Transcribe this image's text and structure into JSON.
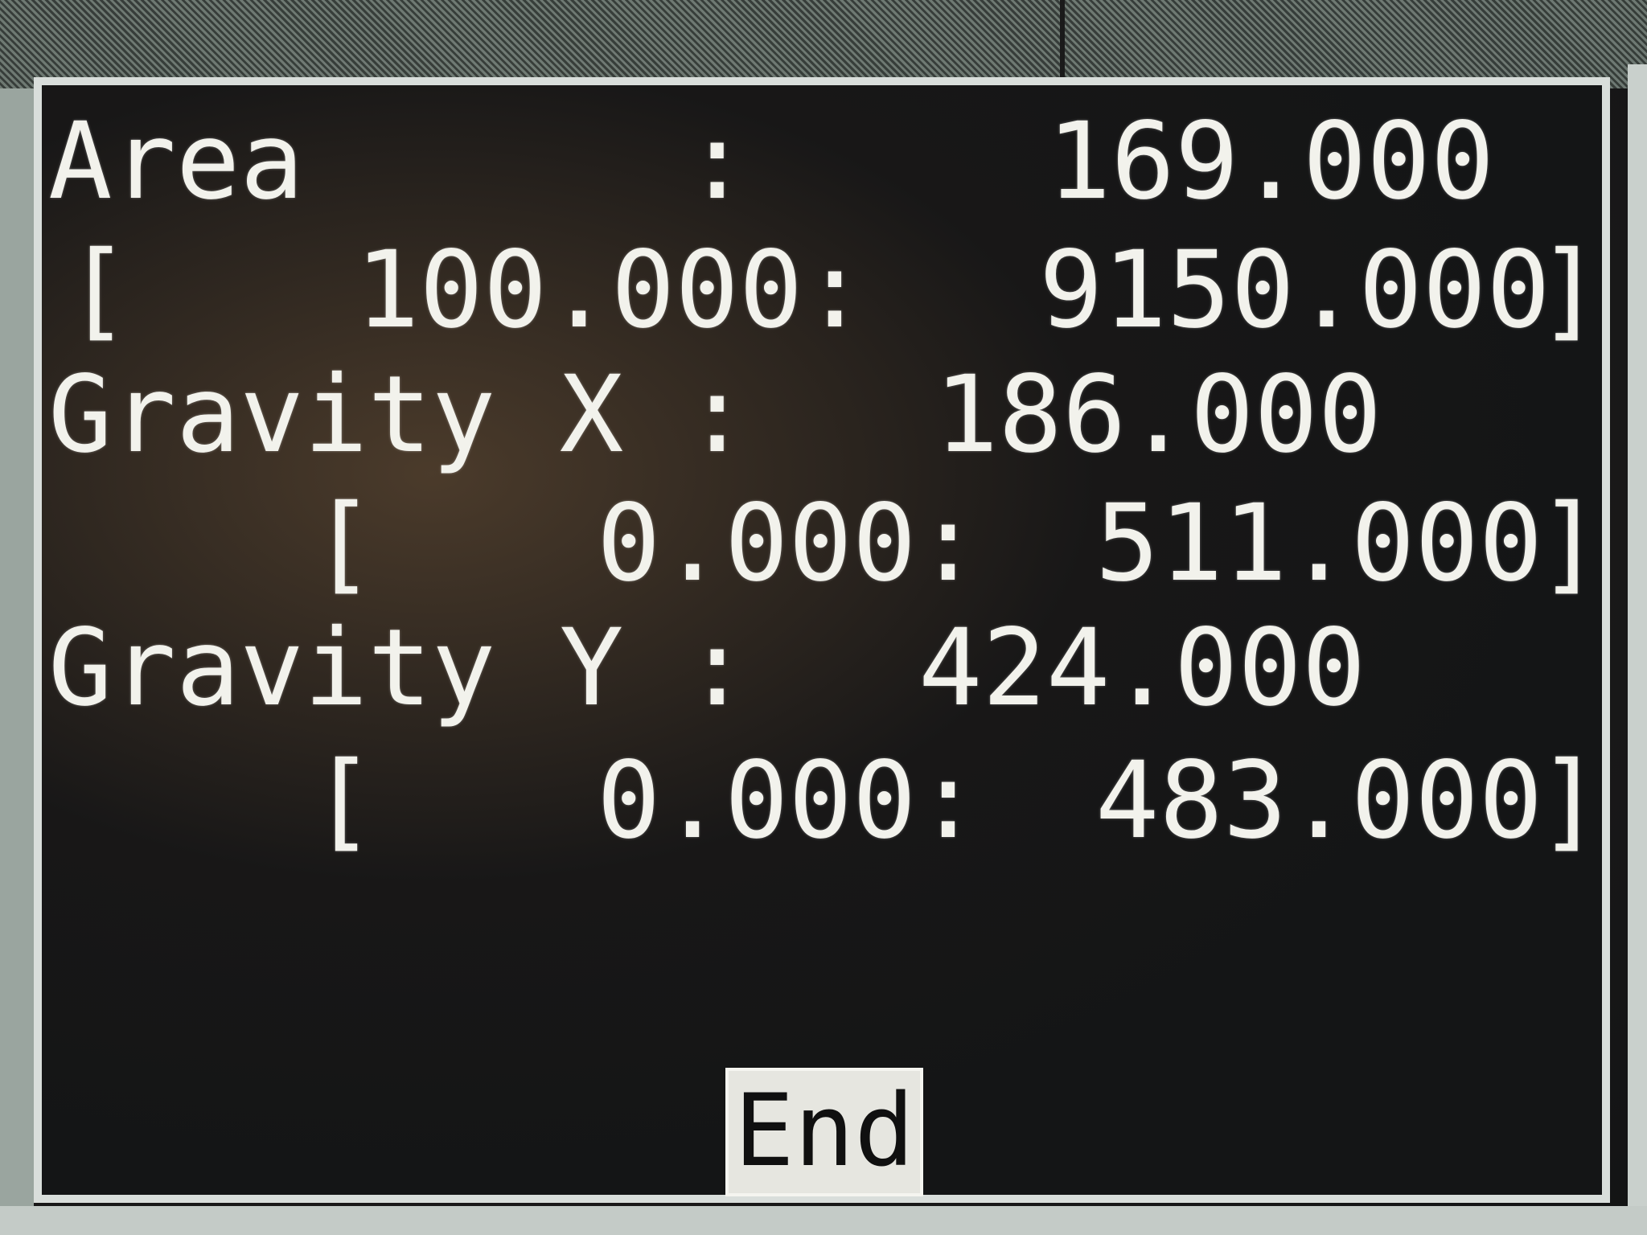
{
  "dialog": {
    "area": {
      "label": "Area",
      "colon": ":",
      "value": "169.000",
      "range_open": "[",
      "range_min": "100.000:",
      "range_max": "9150.000",
      "range_close": "]"
    },
    "gravity_x": {
      "label": "Gravity X",
      "colon": ":",
      "value": "186.000",
      "range_open": "[",
      "range_min": "0.000:",
      "range_max": "511.000",
      "range_close": "]"
    },
    "gravity_y": {
      "label": "Gravity Y",
      "colon": ":",
      "value": "424.000",
      "range_open": "[",
      "range_min": "0.000:",
      "range_max": "483.000",
      "range_close": "]"
    },
    "end_button_label": "End"
  }
}
